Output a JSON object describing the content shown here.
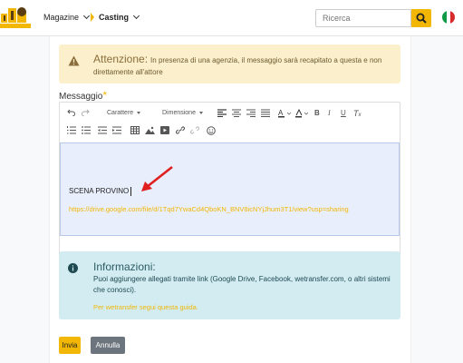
{
  "navbar": {
    "magazine_label": "Magazine",
    "casting_label": "Casting",
    "search_placeholder": "Ricerca"
  },
  "warning": {
    "title": "Attenzione:",
    "text": "In presenza di una agenzia, il messaggio sarà recapitato a questa e non direttamente all'attore"
  },
  "message": {
    "label": "Messaggio",
    "required_mark": "*"
  },
  "toolbar": {
    "font_label": "Carattere",
    "size_label": "Dimensione",
    "bold": "B",
    "italic": "I",
    "underline": "U",
    "clear_format": "T"
  },
  "editor_content": {
    "line1": "SCENA PROVINO",
    "link": "https://drive.google.com/file/d/1Tqd7YwaCd4QboKN_BNV8icNYjJhum3T1/view?usp=sharing"
  },
  "info": {
    "title": "Informazioni:",
    "text": "Puoi aggiungere allegati tramite link (Google Drive, Facebook, wetransfer.com, o altri sistemi che conosci).",
    "link": "Per wetransfer segui questa guida."
  },
  "buttons": {
    "send": "Invia",
    "cancel": "Annulla"
  },
  "colors": {
    "accent": "#f2b705",
    "warning_bg": "#fcf0cc",
    "info_bg": "#d2ecf1",
    "editor_bg": "#e8eefb",
    "cancel_bg": "#6c757d",
    "arrow": "#e02020"
  }
}
